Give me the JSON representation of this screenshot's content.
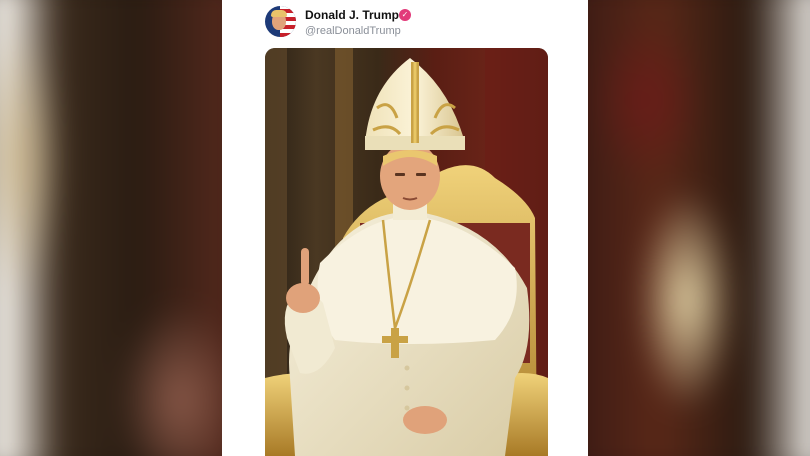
{
  "post": {
    "author_name": "Donald J. Trump",
    "handle": "@realDonaldTrump",
    "verified_icon": "verified-badge-icon",
    "image_alt": "AI-generated image of Donald Trump dressed as the Pope"
  },
  "colors": {
    "verified": "#e23a7a",
    "handle": "#8a8f98",
    "name": "#111111"
  }
}
